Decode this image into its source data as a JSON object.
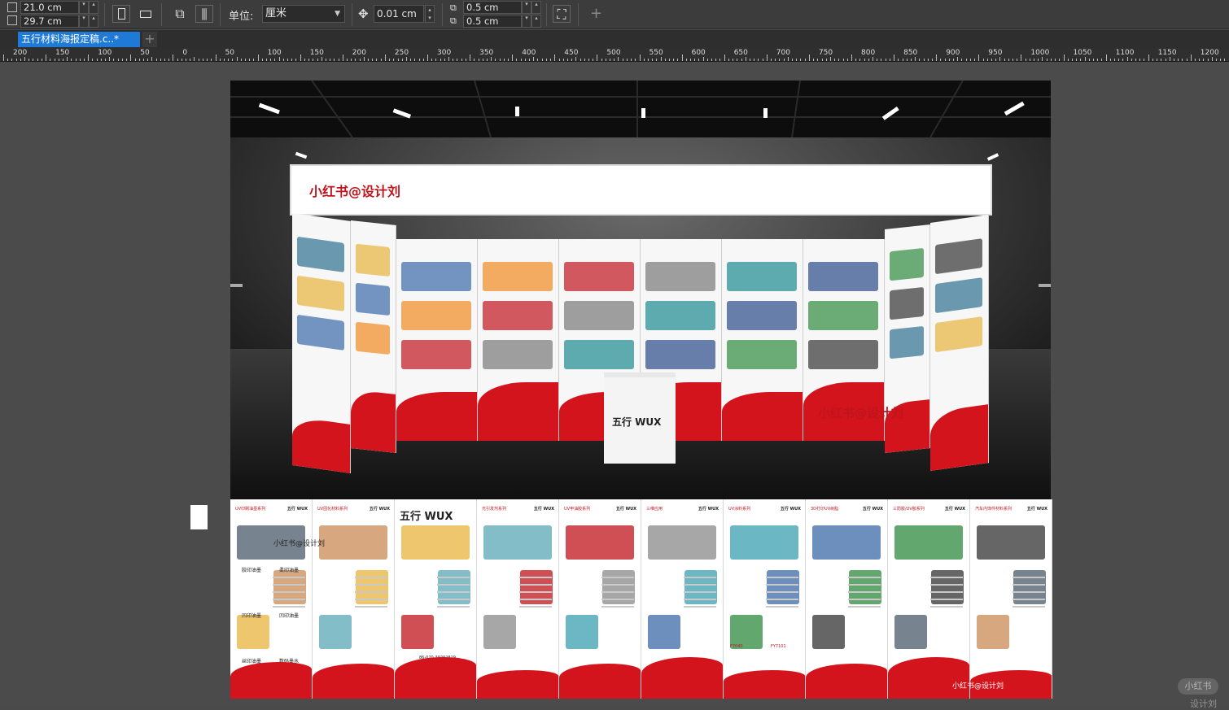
{
  "toolbar": {
    "width_value": "21.0 cm",
    "height_value": "29.7 cm",
    "units_label": "单位:",
    "units_value": "厘米",
    "nudge_value": "0.01 cm",
    "dup_x_value": "0.5 cm",
    "dup_y_value": "0.5 cm",
    "add_symbol": "+"
  },
  "tabs": [
    {
      "label": "五行材料海报定稿.c..*"
    }
  ],
  "ruler": {
    "labels": [
      "200",
      "150",
      "100",
      "50",
      "0",
      "50",
      "100",
      "150",
      "200",
      "250",
      "300",
      "350",
      "400",
      "450",
      "500",
      "550",
      "600",
      "650",
      "700",
      "750",
      "800",
      "850",
      "900",
      "950",
      "1000",
      "1050",
      "1100",
      "1150",
      "1200"
    ]
  },
  "document": {
    "banner_title": "小红书@设计刘",
    "booth_logo": "五行 WUX",
    "overlay_watermark": "小红书@设计刘",
    "strip_watermark_mid": "小红书@设计刘",
    "strip_footer": "小红书@设计刘",
    "panel_logo": "五行 WUX",
    "strip_panels": [
      {
        "heading": "UV印刷油墨系列",
        "captions": [
          "胶印油墨",
          "柔印油墨",
          "凹印油墨",
          "凹印油墨",
          "丝印油墨",
          "数码墨水"
        ]
      },
      {
        "heading": "UV固化材料系列"
      },
      {
        "heading": "五行 WUX",
        "contact": "86-020-39292819"
      },
      {
        "heading": "光引发剂系列"
      },
      {
        "heading": "UV甲油胶系列"
      },
      {
        "heading": "三维应用"
      },
      {
        "heading": "UV涂料系列",
        "codes": [
          "F7040",
          "FY7101"
        ]
      },
      {
        "heading": "3D打印UV树脂"
      },
      {
        "heading": "三防胶/UV胶系列"
      },
      {
        "heading": "汽车内饰件材料系列"
      }
    ]
  },
  "watermark": {
    "badge": "小红书",
    "text": "设计刘"
  },
  "colors": {
    "accent_red": "#d3141c",
    "tab_blue": "#1e7ad6",
    "toolbar_bg": "#3c3c3c"
  }
}
